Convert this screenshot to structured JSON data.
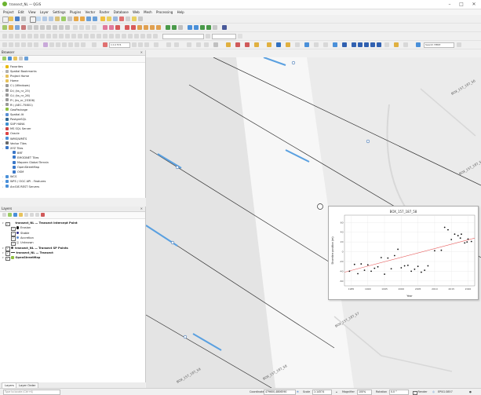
{
  "window": {
    "title": "transect_NL — QGIS",
    "minimize": "–",
    "maximize": "□",
    "close": "✕"
  },
  "menu": [
    "Project",
    "Edit",
    "View",
    "Layer",
    "Settings",
    "Plugins",
    "Vector",
    "Raster",
    "Database",
    "Web",
    "Mesh",
    "Processing",
    "Help"
  ],
  "toolbar": {
    "scale_value": "1:14 574",
    "search_placeholder": "Search HERE"
  },
  "browser": {
    "title": "Browser",
    "items": [
      {
        "label": "Favorites",
        "indent": 1,
        "icon": "star-icon",
        "color": "#e8b800"
      },
      {
        "label": "Spatial Bookmarks",
        "indent": 1,
        "icon": "bookmark-icon",
        "color": "#b0b0b0"
      },
      {
        "label": "Project Home",
        "indent": 1,
        "icon": "folder-icon",
        "color": "#e6c15a"
      },
      {
        "label": "Home",
        "indent": 1,
        "icon": "folder-icon",
        "color": "#e6c15a"
      },
      {
        "label": "C:\\ (Windows)",
        "indent": 1,
        "icon": "drive-icon",
        "color": "#9a9a9a"
      },
      {
        "label": "D:\\ (ks_nr_25)",
        "indent": 1,
        "icon": "drive-icon",
        "color": "#9a9a9a"
      },
      {
        "label": "G:\\ (ks_nr_26)",
        "indent": 1,
        "icon": "drive-icon",
        "color": "#9a9a9a"
      },
      {
        "label": "P:\\ (ks_nr_25306)",
        "indent": 1,
        "icon": "drive-icon",
        "color": "#9a9a9a"
      },
      {
        "label": "R:\\ (AEC-75801)",
        "indent": 1,
        "icon": "drive-icon",
        "color": "#9a9a9a"
      },
      {
        "label": "GeoPackage",
        "indent": 1,
        "icon": "geopackage-icon",
        "color": "#8fbf3f"
      },
      {
        "label": "Spatial-lit",
        "indent": 1,
        "icon": "spatialite-icon",
        "color": "#5a8fd6"
      },
      {
        "label": "PostgreSQL",
        "indent": 1,
        "icon": "postgresql-icon",
        "color": "#336791"
      },
      {
        "label": "SAP HANA",
        "indent": 1,
        "icon": "database-icon",
        "color": "#3c8fd0"
      },
      {
        "label": "MS SQL Server",
        "indent": 1,
        "icon": "database-icon",
        "color": "#c44"
      },
      {
        "label": "Oracle",
        "indent": 1,
        "icon": "database-icon",
        "color": "#d44"
      },
      {
        "label": "WMS/WMTS",
        "indent": 1,
        "icon": "globe-icon",
        "color": "#4a90d9"
      },
      {
        "label": "Vector Tiles",
        "indent": 1,
        "icon": "grid-icon",
        "color": "#6a6a6a"
      },
      {
        "label": "XYZ Tiles",
        "indent": 1,
        "icon": "grid-icon",
        "color": "#3b78c9"
      },
      {
        "label": "BRT",
        "indent": 2,
        "icon": "tile-icon",
        "color": "#3b78c9"
      },
      {
        "label": "EMODNET Tiles",
        "indent": 2,
        "icon": "tile-icon",
        "color": "#3b78c9"
      },
      {
        "label": "Mapzen Global Terrain",
        "indent": 2,
        "icon": "tile-icon",
        "color": "#3b78c9"
      },
      {
        "label": "OpenStreetMap",
        "indent": 2,
        "icon": "tile-icon",
        "color": "#3b78c9"
      },
      {
        "label": "OSM",
        "indent": 2,
        "icon": "tile-icon",
        "color": "#3b78c9"
      },
      {
        "label": "WCS",
        "indent": 1,
        "icon": "globe-icon",
        "color": "#4a90d9"
      },
      {
        "label": "WFS / OGC API - Features",
        "indent": 1,
        "icon": "globe-icon",
        "color": "#4a90d9"
      },
      {
        "label": "ArcGIS REST Servers",
        "indent": 1,
        "icon": "globe-icon",
        "color": "#4a90d9"
      }
    ]
  },
  "layers": {
    "title": "Layers",
    "items": [
      {
        "label": "transect_NL — Transect Intercept Point",
        "indent": 1,
        "bold": true,
        "checked": true,
        "symbol": ""
      },
      {
        "label": "Erosion",
        "indent": 3,
        "bold": false,
        "checked": true,
        "symbol": "#111111"
      },
      {
        "label": "Stable",
        "indent": 3,
        "bold": false,
        "checked": true,
        "symbol": "#2a2a8a"
      },
      {
        "label": "Accretion",
        "indent": 3,
        "bold": false,
        "checked": true,
        "symbol": "#5a8ad0"
      },
      {
        "label": "Unknown",
        "indent": 3,
        "bold": false,
        "checked": true,
        "symbol": "#cccccc"
      },
      {
        "label": "transect_NL — Transect SP Points",
        "indent": 1,
        "bold": true,
        "checked": true,
        "symbol": "#444444"
      },
      {
        "label": "transect_NL — Transect",
        "indent": 1,
        "bold": true,
        "checked": true,
        "symbol": "line"
      },
      {
        "label": "OpenStreetMap",
        "indent": 1,
        "bold": true,
        "checked": true,
        "symbol": "grid"
      }
    ]
  },
  "bottom_tabs": [
    "Layers",
    "Layer Order"
  ],
  "map": {
    "labels": [
      "BOX_157_187_55",
      "BOX_157_187_56",
      "BOX_157_187_57",
      "BOX_157_187_58",
      "BOX_157_187_59"
    ]
  },
  "chart_data": {
    "type": "scatter",
    "title": "BOX_157_187_58",
    "xlabel": "Year",
    "ylabel": "Shoreline position (m)",
    "x_ticks": [
      "1985",
      "1990",
      "1995",
      "2000",
      "2005",
      "2010",
      "2015",
      "2020"
    ],
    "y_ticks": [
      "-60",
      "-40",
      "-20",
      "0",
      "20",
      "40",
      "60"
    ],
    "xlim": [
      1983,
      2022
    ],
    "ylim": [
      -70,
      75
    ],
    "points": [
      {
        "x": 1984.5,
        "y": -40
      },
      {
        "x": 1986,
        "y": -26
      },
      {
        "x": 1987,
        "y": -45
      },
      {
        "x": 1988,
        "y": -25
      },
      {
        "x": 1989,
        "y": -38
      },
      {
        "x": 1990,
        "y": -27
      },
      {
        "x": 1991,
        "y": -40
      },
      {
        "x": 1992,
        "y": -34
      },
      {
        "x": 1993,
        "y": -31
      },
      {
        "x": 1994,
        "y": -12
      },
      {
        "x": 1995,
        "y": -46
      },
      {
        "x": 1996,
        "y": -13
      },
      {
        "x": 1997,
        "y": -35
      },
      {
        "x": 1998,
        "y": -8
      },
      {
        "x": 1999,
        "y": 5
      },
      {
        "x": 2000,
        "y": -33
      },
      {
        "x": 2001,
        "y": -29
      },
      {
        "x": 2002,
        "y": -28
      },
      {
        "x": 2003,
        "y": -40
      },
      {
        "x": 2004,
        "y": -36
      },
      {
        "x": 2005,
        "y": -30
      },
      {
        "x": 2006,
        "y": -42
      },
      {
        "x": 2007,
        "y": -38
      },
      {
        "x": 2008,
        "y": -29
      },
      {
        "x": 2010,
        "y": 2
      },
      {
        "x": 2012,
        "y": 3
      },
      {
        "x": 2013,
        "y": 50
      },
      {
        "x": 2014,
        "y": 45
      },
      {
        "x": 2015,
        "y": 25
      },
      {
        "x": 2016,
        "y": 36
      },
      {
        "x": 2017,
        "y": 33
      },
      {
        "x": 2017.7,
        "y": 28
      },
      {
        "x": 2018,
        "y": 36
      },
      {
        "x": 2019,
        "y": 18
      },
      {
        "x": 2019.7,
        "y": 20
      },
      {
        "x": 2020,
        "y": 26
      },
      {
        "x": 2021,
        "y": 21
      }
    ],
    "trend": {
      "x": [
        1983,
        2022
      ],
      "y": [
        -42,
        28
      ]
    }
  },
  "status": {
    "search_placeholder": "Type to locate (Ctrl+K)",
    "coordinate_label": "Coordinate",
    "coordinate": "479600,4806590",
    "scale_label": "Scale",
    "scale": "1:14574",
    "magnifier_label": "Magnifier",
    "magnifier": "100%",
    "rotation_label": "Rotation",
    "rotation": "0.0 °",
    "render_label": "Render",
    "crs": "EPSG:3857"
  },
  "colors": {
    "accent": "#3b78c9",
    "beach": "#f3f3f3",
    "land": "#ebebeb",
    "water": "#e4e4e4",
    "trend": "#e86060"
  }
}
